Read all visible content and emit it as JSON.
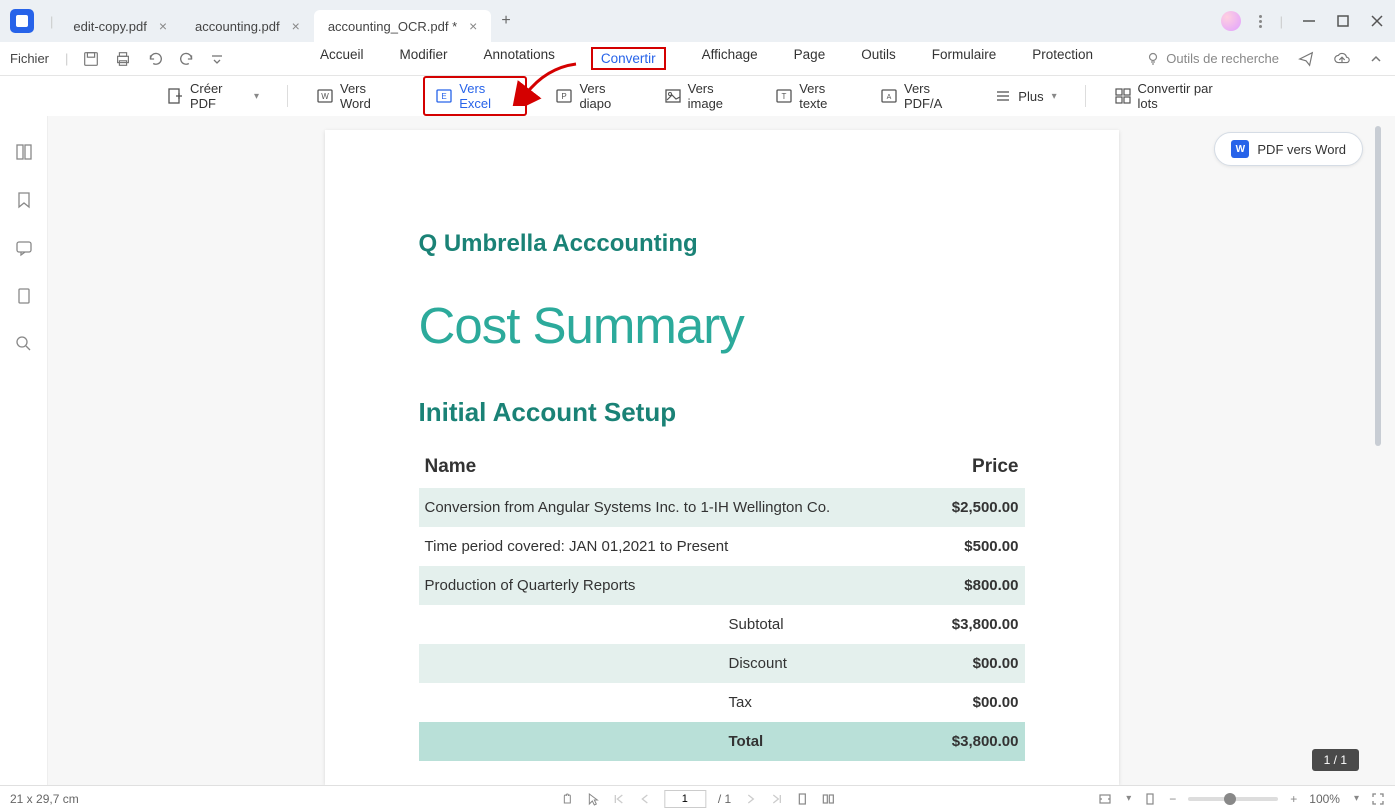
{
  "tabs": [
    {
      "title": "edit-copy.pdf",
      "active": false
    },
    {
      "title": "accounting.pdf",
      "active": false
    },
    {
      "title": "accounting_OCR.pdf *",
      "active": true
    }
  ],
  "file_menu": "Fichier",
  "menu": {
    "accueil": "Accueil",
    "modifier": "Modifier",
    "annotations": "Annotations",
    "convertir": "Convertir",
    "affichage": "Affichage",
    "page": "Page",
    "outils": "Outils",
    "formulaire": "Formulaire",
    "protection": "Protection"
  },
  "search_tools": "Outils de recherche",
  "ribbon": {
    "creer": "Créer PDF",
    "word": "Vers Word",
    "excel": "Vers Excel",
    "diapo": "Vers diapo",
    "image": "Vers image",
    "texte": "Vers texte",
    "pdfa": "Vers PDF/A",
    "plus": "Plus",
    "batch": "Convertir par lots"
  },
  "floating": {
    "label": "PDF vers Word"
  },
  "doc": {
    "company": "Q Umbrella Acccounting",
    "title": "Cost Summary",
    "section": "Initial Account Setup",
    "th_name": "Name",
    "th_price": "Price",
    "rows": [
      {
        "name": "Conversion from Angular Systems Inc. to 1-IH Wellington Co.",
        "price": "$2,500.00"
      },
      {
        "name": "Time period covered: JAN 01,2021 to Present",
        "price": "$500.00"
      },
      {
        "name": "Production of Quarterly Reports",
        "price": "$800.00"
      }
    ],
    "summary": [
      {
        "label": "Subtotal",
        "value": "$3,800.00",
        "shade": false
      },
      {
        "label": "Discount",
        "value": "$00.00",
        "shade": true
      },
      {
        "label": "Tax",
        "value": "$00.00",
        "shade": false
      },
      {
        "label": "Total",
        "value": "$3,800.00",
        "total": true
      }
    ]
  },
  "page_indicator": "1 / 1",
  "status": {
    "dimensions": "21 x 29,7 cm",
    "page_current": "1",
    "page_total": "/ 1",
    "zoom": "100%"
  }
}
